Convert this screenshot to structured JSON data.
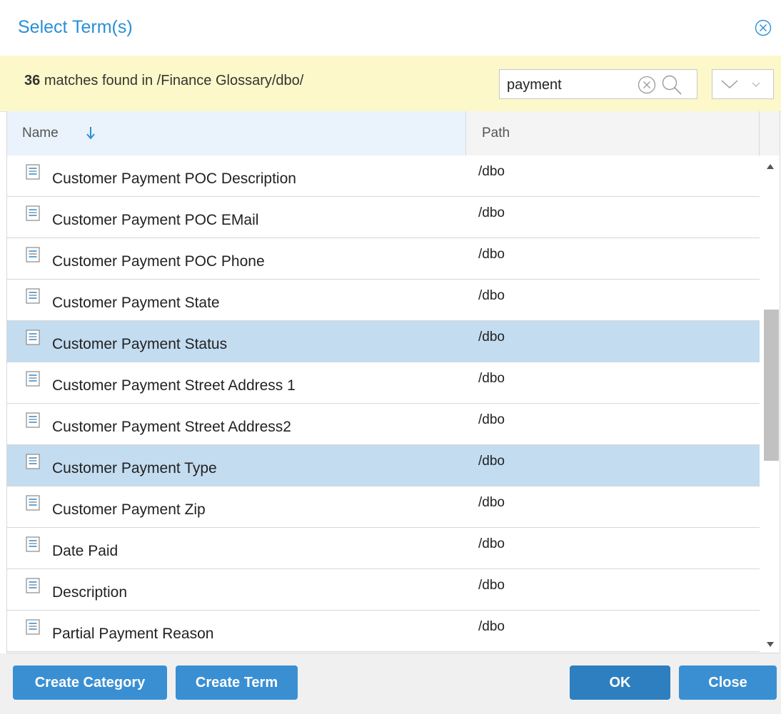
{
  "dialog": {
    "title": "Select Term(s)"
  },
  "search": {
    "match_count": "36",
    "match_text": "matches found in /Finance Glossary/dbo/",
    "query": "payment"
  },
  "grid": {
    "columns": {
      "name": "Name",
      "path": "Path"
    },
    "rows": [
      {
        "name": "Customer Payment POC Description",
        "path": "/dbo",
        "selected": false
      },
      {
        "name": "Customer Payment POC EMail",
        "path": "/dbo",
        "selected": false
      },
      {
        "name": "Customer Payment POC Phone",
        "path": "/dbo",
        "selected": false
      },
      {
        "name": "Customer Payment State",
        "path": "/dbo",
        "selected": false
      },
      {
        "name": "Customer Payment Status",
        "path": "/dbo",
        "selected": true
      },
      {
        "name": "Customer Payment Street Address 1",
        "path": "/dbo",
        "selected": false
      },
      {
        "name": "Customer Payment Street Address2",
        "path": "/dbo",
        "selected": false
      },
      {
        "name": "Customer Payment Type",
        "path": "/dbo",
        "selected": true
      },
      {
        "name": "Customer Payment Zip",
        "path": "/dbo",
        "selected": false
      },
      {
        "name": "Date Paid",
        "path": "/dbo",
        "selected": false
      },
      {
        "name": "Description",
        "path": "/dbo",
        "selected": false
      },
      {
        "name": "Partial Payment Reason",
        "path": "/dbo",
        "selected": false
      }
    ]
  },
  "footer": {
    "create_category": "Create Category",
    "create_term": "Create Term",
    "ok": "OK",
    "close": "Close"
  },
  "colors": {
    "accent": "#2a8fd7",
    "button": "#3a8fd2",
    "selected_row": "#c3dcf0",
    "search_bar_bg": "#fcf8c9"
  }
}
